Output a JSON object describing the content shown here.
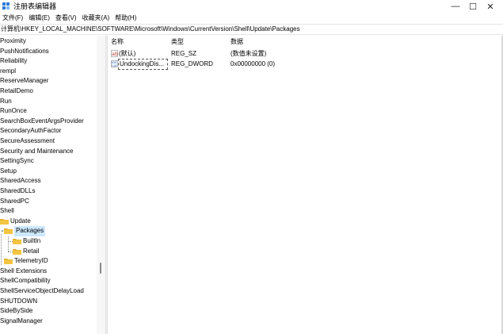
{
  "window": {
    "title": "注册表编辑器",
    "controls": {
      "minimize": "—",
      "maximize": "☐",
      "close": "✕"
    }
  },
  "menu": [
    "文件(F)",
    "编辑(E)",
    "查看(V)",
    "收藏夹(A)",
    "帮助(H)"
  ],
  "address": "计算机\\HKEY_LOCAL_MACHINE\\SOFTWARE\\Microsoft\\Windows\\CurrentVersion\\Shell\\Update\\Packages",
  "tree": [
    {
      "label": "Proximity",
      "depth": 0
    },
    {
      "label": "PushNotifications",
      "depth": 0
    },
    {
      "label": "Reliability",
      "depth": 0
    },
    {
      "label": "rempl",
      "depth": 0
    },
    {
      "label": "ReserveManager",
      "depth": 0
    },
    {
      "label": "RetailDemo",
      "depth": 0
    },
    {
      "label": "Run",
      "depth": 0
    },
    {
      "label": "RunOnce",
      "depth": 0
    },
    {
      "label": "SearchBoxEventArgsProvider",
      "depth": 0
    },
    {
      "label": "SecondaryAuthFactor",
      "depth": 0
    },
    {
      "label": "SecureAssessment",
      "depth": 0
    },
    {
      "label": "Security and Maintenance",
      "depth": 0
    },
    {
      "label": "SettingSync",
      "depth": 0
    },
    {
      "label": "Setup",
      "depth": 0
    },
    {
      "label": "SharedAccess",
      "depth": 0
    },
    {
      "label": "SharedDLLs",
      "depth": 0
    },
    {
      "label": "SharedPC",
      "depth": 0
    },
    {
      "label": "Shell",
      "depth": 0
    },
    {
      "label": "Update",
      "depth": 1
    },
    {
      "label": "Packages",
      "depth": 2,
      "selected": true,
      "expanded": true
    },
    {
      "label": "BuiltIn",
      "depth": 3
    },
    {
      "label": "Retail",
      "depth": 3
    },
    {
      "label": "TelemetryID",
      "depth": 2
    },
    {
      "label": "Shell Extensions",
      "depth": 0
    },
    {
      "label": "ShellCompatibility",
      "depth": 0
    },
    {
      "label": "ShellServiceObjectDelayLoad",
      "depth": 0
    },
    {
      "label": "SHUTDOWN",
      "depth": 0
    },
    {
      "label": "SideBySide",
      "depth": 0
    },
    {
      "label": "SignalManager",
      "depth": 0
    }
  ],
  "list": {
    "headers": {
      "name": "名称",
      "type": "类型",
      "data": "数据"
    },
    "rows": [
      {
        "name": "(默认)",
        "type": "REG_SZ",
        "data": "(数值未设置)",
        "icon": "string-value-icon"
      },
      {
        "name": "UndockingDis...",
        "type": "REG_DWORD",
        "data": "0x00000000 (0)",
        "icon": "binary-value-icon",
        "editing": true
      }
    ]
  },
  "colors": {
    "selection": "#cce8ff",
    "folder": "#f4c542",
    "folder_dark": "#dcaa22",
    "string_icon": "#c0392b",
    "binary_icon": "#1f5fbf"
  }
}
